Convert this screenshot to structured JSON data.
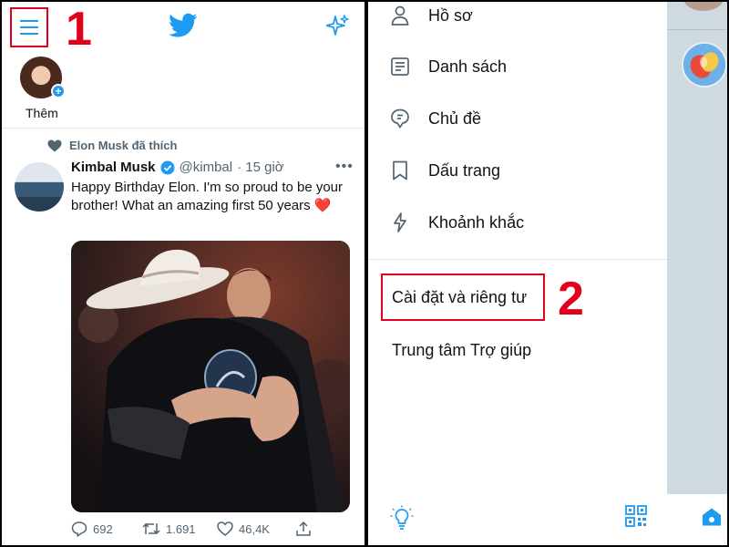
{
  "annotations": {
    "step1": "1",
    "step2": "2"
  },
  "header": {
    "menu_icon": "hamburger-menu-icon",
    "logo_icon": "twitter-bird-icon",
    "sparkle_icon": "sparkle-icon"
  },
  "story": {
    "label": "Thêm"
  },
  "tweet": {
    "context": "Elon Musk đã thích",
    "name": "Kimbal Musk",
    "handle": "@kimbal",
    "time": "· 15 giờ",
    "text": "Happy Birthday Elon. I'm so proud to be your brother! What an amazing first 50 years ❤️",
    "replies": "692",
    "retweets": "1.691",
    "likes": "46,4K"
  },
  "drawer": {
    "items": [
      {
        "label": "Hồ sơ",
        "icon": "profile-icon"
      },
      {
        "label": "Danh sách",
        "icon": "list-icon"
      },
      {
        "label": "Chủ đề",
        "icon": "topics-icon"
      },
      {
        "label": "Dấu trang",
        "icon": "bookmark-icon"
      },
      {
        "label": "Khoảnh khắc",
        "icon": "moments-icon"
      }
    ],
    "settings": "Cài đặt và riêng tư",
    "help": "Trung tâm Trợ giúp"
  },
  "colors": {
    "accent": "#1d9bf0",
    "annotation": "#e2001a",
    "like": "#e0245e"
  }
}
